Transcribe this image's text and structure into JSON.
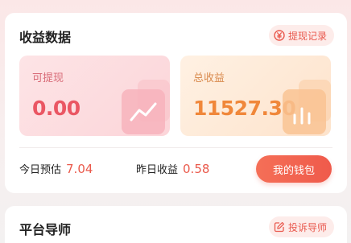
{
  "earnings": {
    "title": "收益数据",
    "withdraw_record_label": "提现记录",
    "withdrawable": {
      "label": "可提现",
      "value": "0.00"
    },
    "total": {
      "label": "总收益",
      "value": "11527.30"
    },
    "today": {
      "label": "今日预估",
      "value": "7.04"
    },
    "yesterday": {
      "label": "昨日收益",
      "value": "0.58"
    },
    "wallet_button_label": "我的钱包"
  },
  "mentor": {
    "title": "平台导师",
    "complaint_label": "投诉导师"
  },
  "colors": {
    "accent": "#ef5a4b",
    "withdrawable_value": "#ea5663",
    "total_value": "#f0873a"
  },
  "icons": {
    "withdraw_record": "yuan-coin-icon",
    "withdrawable_deco": "trend-chart-icon",
    "total_deco": "bar-chart-icon",
    "complaint": "edit-icon"
  }
}
